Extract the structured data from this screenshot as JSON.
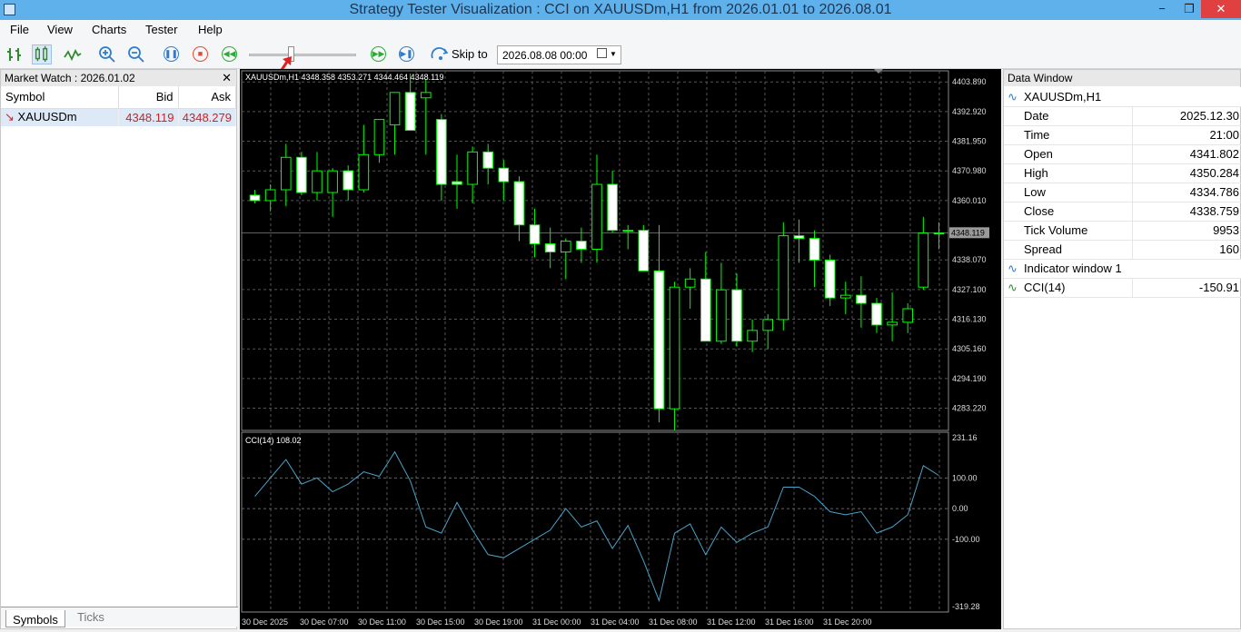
{
  "window": {
    "title": "Strategy Tester Visualization : CCI on XAUUSDm,H1 from 2026.01.01 to 2026.08.01"
  },
  "menu": [
    "File",
    "View",
    "Charts",
    "Tester",
    "Help"
  ],
  "toolbar": {
    "skip_label": "Skip to",
    "skip_value": "2026.08.08 00:00",
    "speed_fraction": 0.38
  },
  "market_watch": {
    "title": "Market Watch : 2026.01.02",
    "columns": [
      "Symbol",
      "Bid",
      "Ask"
    ],
    "rows": [
      {
        "symbol": "XAUUSDm",
        "bid": "4348.119",
        "ask": "4348.279"
      }
    ],
    "tabs": [
      "Symbols",
      "Ticks"
    ]
  },
  "chart": {
    "main_label": "XAUUSDm,H1  4348.358 4353.271 4344.464 4348.119",
    "indicator_label": "CCI(14) 108.02",
    "price_axis": [
      "4403.890",
      "4392.920",
      "4381.950",
      "4370.980",
      "4360.010",
      "4338.070",
      "4327.100",
      "4316.130",
      "4305.160",
      "4294.190",
      "4283.220"
    ],
    "current_price": "4348.119",
    "cci_axis": [
      "231.16",
      "100.00",
      "0.00",
      "-100.00",
      "-319.28"
    ],
    "time_axis": [
      "30 Dec 2025",
      "30 Dec 07:00",
      "30 Dec 11:00",
      "30 Dec 15:00",
      "30 Dec 19:00",
      "31 Dec 00:00",
      "31 Dec 04:00",
      "31 Dec 08:00",
      "31 Dec 12:00",
      "31 Dec 16:00",
      "31 Dec 20:00"
    ]
  },
  "chart_data": {
    "type": "candlestick",
    "symbol": "XAUUSDm,H1",
    "price_range": [
      4275,
      4408
    ],
    "candles": [
      [
        4362,
        4364,
        4359,
        4360
      ],
      [
        4360,
        4366,
        4356,
        4364
      ],
      [
        4364,
        4381,
        4358,
        4376
      ],
      [
        4376,
        4378,
        4362,
        4363
      ],
      [
        4363,
        4378,
        4360,
        4371
      ],
      [
        4363,
        4372,
        4354,
        4371
      ],
      [
        4371,
        4373,
        4360,
        4364
      ],
      [
        4364,
        4388,
        4363,
        4377
      ],
      [
        4377,
        4388,
        4374,
        4390
      ],
      [
        4388,
        4390,
        4377,
        4400
      ],
      [
        4400,
        4407,
        4386,
        4386
      ],
      [
        4398,
        4405,
        4377,
        4400
      ],
      [
        4390,
        4392,
        4360,
        4366
      ],
      [
        4367,
        4377,
        4357,
        4366
      ],
      [
        4366,
        4380,
        4359,
        4378
      ],
      [
        4378,
        4381,
        4366,
        4372
      ],
      [
        4372,
        4375,
        4360,
        4367
      ],
      [
        4367,
        4369,
        4345,
        4351
      ],
      [
        4351,
        4357,
        4339,
        4344
      ],
      [
        4344,
        4350,
        4335,
        4341
      ],
      [
        4341,
        4346,
        4331,
        4345
      ],
      [
        4345,
        4350,
        4337,
        4342
      ],
      [
        4342,
        4377,
        4337,
        4366
      ],
      [
        4366,
        4371,
        4348,
        4349
      ],
      [
        4349,
        4351,
        4342,
        4349
      ],
      [
        4349,
        4351,
        4334,
        4334
      ],
      [
        4334,
        4351,
        4278,
        4283
      ],
      [
        4283,
        4330,
        4275,
        4328
      ],
      [
        4328,
        4335,
        4320,
        4331
      ],
      [
        4331,
        4341,
        4310,
        4308
      ],
      [
        4308,
        4337,
        4307,
        4327
      ],
      [
        4327,
        4333,
        4306,
        4308
      ],
      [
        4308,
        4316,
        4304,
        4312
      ],
      [
        4312,
        4318,
        4305,
        4316
      ],
      [
        4316,
        4352,
        4312,
        4347
      ],
      [
        4347,
        4353,
        4337,
        4346
      ],
      [
        4346,
        4349,
        4328,
        4338
      ],
      [
        4338,
        4340,
        4321,
        4324
      ],
      [
        4324,
        4330,
        4318,
        4325
      ],
      [
        4325,
        4332,
        4313,
        4322
      ],
      [
        4322,
        4324,
        4311,
        4314
      ],
      [
        4314,
        4326,
        4308,
        4315
      ],
      [
        4315,
        4322,
        4311,
        4320
      ],
      [
        4328,
        4354,
        4327,
        4348
      ],
      [
        4348,
        4352,
        4342,
        4348
      ]
    ],
    "cci": [
      40,
      100,
      160,
      80,
      100,
      55,
      80,
      120,
      105,
      185,
      90,
      -60,
      -80,
      20,
      -70,
      -150,
      -160,
      -130,
      -100,
      -70,
      0,
      -60,
      -40,
      -130,
      -55,
      -170,
      -300,
      -80,
      -50,
      -150,
      -60,
      -110,
      -80,
      -60,
      70,
      70,
      40,
      -10,
      -20,
      -10,
      -80,
      -60,
      -20,
      140,
      108
    ]
  },
  "data_window": {
    "title": "Data Window",
    "symbol": "XAUUSDm,H1",
    "fields": [
      {
        "k": "Date",
        "v": "2025.12.30"
      },
      {
        "k": "Time",
        "v": "21:00"
      },
      {
        "k": "Open",
        "v": "4341.802"
      },
      {
        "k": "High",
        "v": "4350.284"
      },
      {
        "k": "Low",
        "v": "4334.786"
      },
      {
        "k": "Close",
        "v": "4338.759"
      },
      {
        "k": "Tick Volume",
        "v": "9953"
      },
      {
        "k": "Spread",
        "v": "160"
      }
    ],
    "indicator_group": "Indicator window 1",
    "indicator": {
      "k": "CCI(14)",
      "v": "-150.91"
    }
  },
  "colors": {
    "bull": "#00ff00",
    "bear": "#ffffff",
    "cci": "#4aa3c8",
    "grid": "#5a5a5a",
    "title_bar": "#5fb1ec"
  }
}
